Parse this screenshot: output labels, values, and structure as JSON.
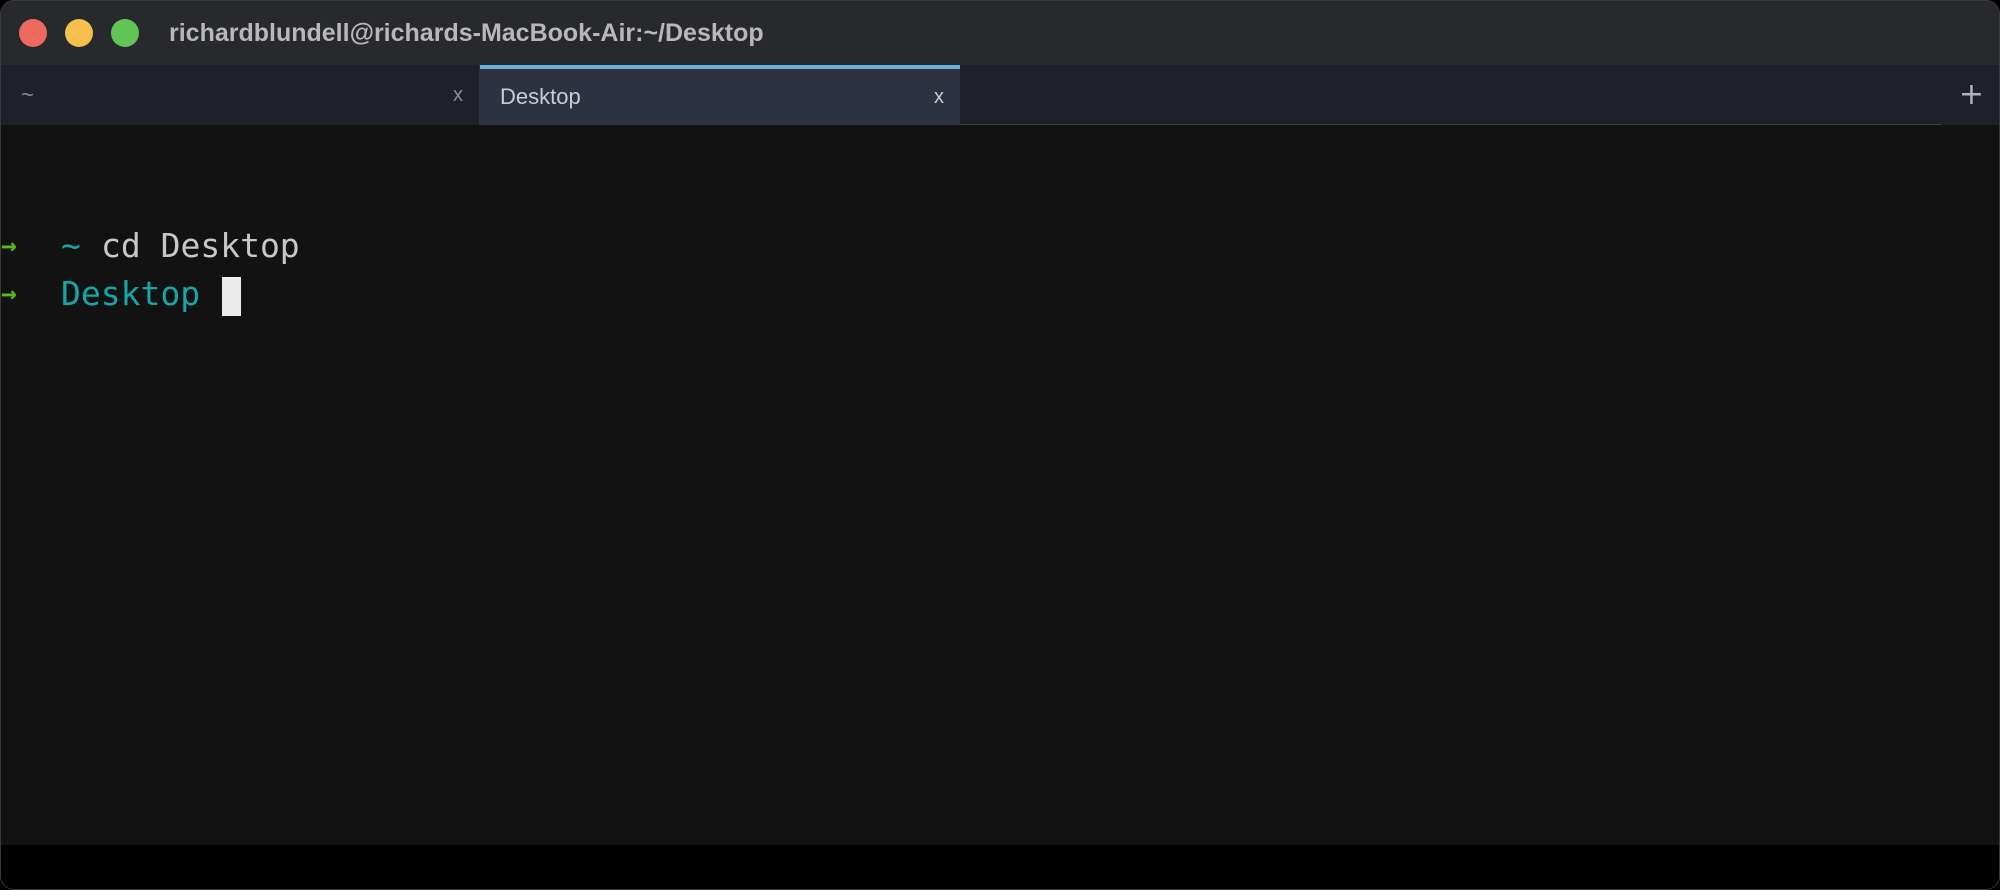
{
  "window": {
    "title": "richardblundell@richards-MacBook-Air:~/Desktop",
    "traffic_lights": {
      "close_color": "#ed6a5e",
      "minimize_color": "#f4bf4f",
      "maximize_color": "#61c554"
    }
  },
  "tabs": [
    {
      "label": "~",
      "close_label": "x",
      "active": false
    },
    {
      "label": "Desktop",
      "close_label": "x",
      "active": true
    }
  ],
  "new_tab_label": "+",
  "terminal": {
    "lines": [
      {
        "arrow": "→",
        "dir": "~",
        "command": "cd Desktop"
      },
      {
        "arrow": "→",
        "dir": "Desktop",
        "command": ""
      }
    ],
    "colors": {
      "arrow": "#5fb41a",
      "dir": "#17a5a5",
      "text": "#c7c7c7",
      "background": "#121212",
      "active_tab_accent": "#6ab0de"
    }
  }
}
